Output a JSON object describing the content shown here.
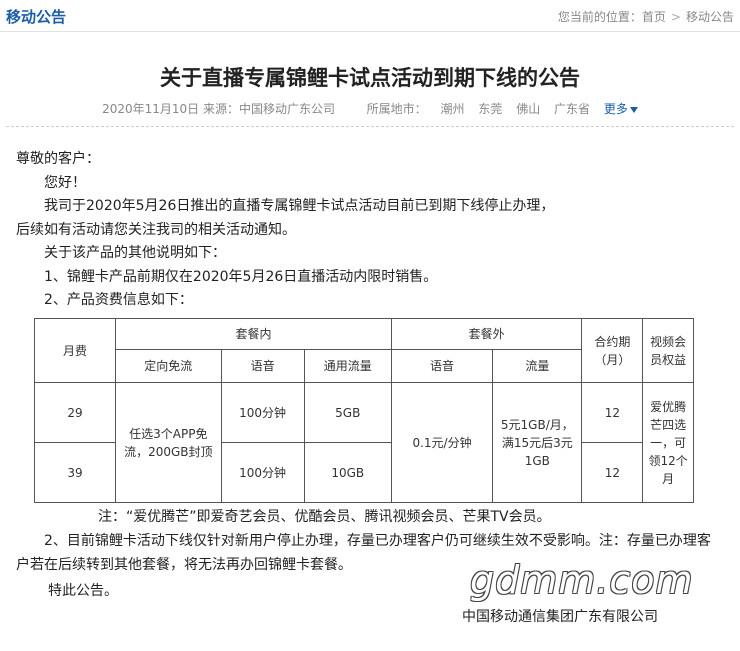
{
  "header": {
    "section_title": "移动公告",
    "breadcrumb_prefix": "您当前的位置：",
    "breadcrumb_home": "首页",
    "breadcrumb_sep": ">",
    "breadcrumb_current": "移动公告"
  },
  "article": {
    "title": "关于直播专属锦鲤卡试点活动到期下线的公告",
    "date": "2020年11月10日",
    "source": "来源：中国移动广东公司",
    "region_label": "所属地市：",
    "regions": [
      "潮州",
      "东莞",
      "佛山",
      "广东省"
    ],
    "more_label": "更多"
  },
  "content": {
    "greeting": "尊敬的客户：",
    "hello": "您好！",
    "para1": "我司于2020年5月26日推出的直播专属锦鲤卡试点活动目前已到期下线停止办理，",
    "para1_cont": "后续如有活动请您关注我司的相关活动通知。",
    "para_other": "关于该产品的其他说明如下：",
    "item1": "1、锦鲤卡产品前期仅在2020年5月26日直播活动内限时销售。",
    "item2": "2、产品资费信息如下：",
    "note": "注：“爱优腾芒”即爱奇艺会员、优酷会员、腾讯视频会员、芒果TV会员。",
    "para2": "2、目前锦鲤卡活动下线仅针对新用户停止办理，存量已办理客户仍可继续生效不受影响。注：存量已办理客户若在后续转到其他套餐，将无法再办回锦鲤卡套餐。",
    "closing": "特此公告。",
    "signature": "中国移动通信集团广东有限公司",
    "watermark": "gdmm.com"
  },
  "table": {
    "h_fee": "月费",
    "h_in": "套餐内",
    "h_out": "套餐外",
    "h_term": "合约期（月）",
    "h_video": "视频会员权益",
    "sub_directed": "定向免流",
    "sub_voice_in": "语音",
    "sub_data": "通用流量",
    "sub_voice_out": "语音",
    "sub_flow": "流量",
    "row1_fee": "29",
    "row2_fee": "39",
    "directed_value": "任选3个APP免流，200GB封顶",
    "row1_voice": "100分钟",
    "row2_voice": "100分钟",
    "row1_data": "5GB",
    "row2_data": "10GB",
    "voice_out": "0.1元/分钟",
    "flow_out": "5元1GB/月，满15元后3元1GB",
    "row1_term": "12",
    "row2_term": "12",
    "video_value": "爱优腾芒四选一，可领12个月"
  },
  "colors": {
    "link": "#1a5ea8",
    "muted": "#888888",
    "text": "#222222"
  }
}
